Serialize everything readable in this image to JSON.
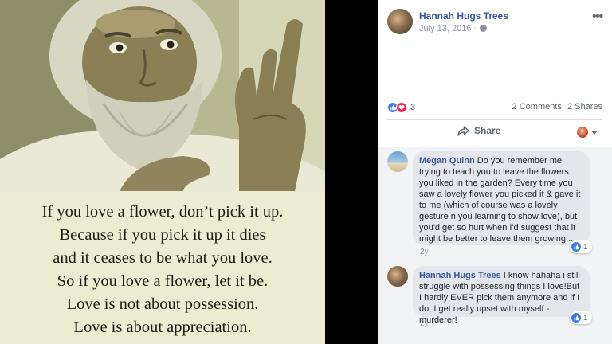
{
  "quote": {
    "lines": [
      "If you love a flower, don’t pick it up.",
      "Because if you pick it up it dies",
      "and it ceases to be what you love.",
      "So if you love a flower, let it be.",
      "Love is not about possession.",
      "Love is about appreciation."
    ]
  },
  "post": {
    "author": "Hannah Hugs Trees",
    "date": "July 13, 2016 ·",
    "more_icon": "more-options-icon",
    "privacy_icon": "globe-icon",
    "reaction_count": "3",
    "comments_count": "2 Comments",
    "shares_count": "2 Shares",
    "share_label": "Share"
  },
  "comments": [
    {
      "name": "Megan Quinn",
      "text": "Do you remember me trying to teach you to leave the flowers you liked in the garden? Every time you saw a lovely flower you picked it & gave it to me (which of course was a lovely gesture n you learning to show love), but you'd get so hurt when I'd suggest that it might be better to leave them growing...",
      "likes": "1",
      "age": "2y"
    },
    {
      "name": "Hannah Hugs Trees",
      "text": "I know hahaha i still struggle with possessing things I love!But I hardly EVER pick them anymore and if I do, I get really upset with myself - murderer!",
      "likes": "1",
      "age": "2y"
    }
  ],
  "colors": {
    "link_blue": "#365899",
    "like_blue": "#3b7bea",
    "love_red": "#f0284a",
    "quote_bg": "#ecedd0"
  }
}
